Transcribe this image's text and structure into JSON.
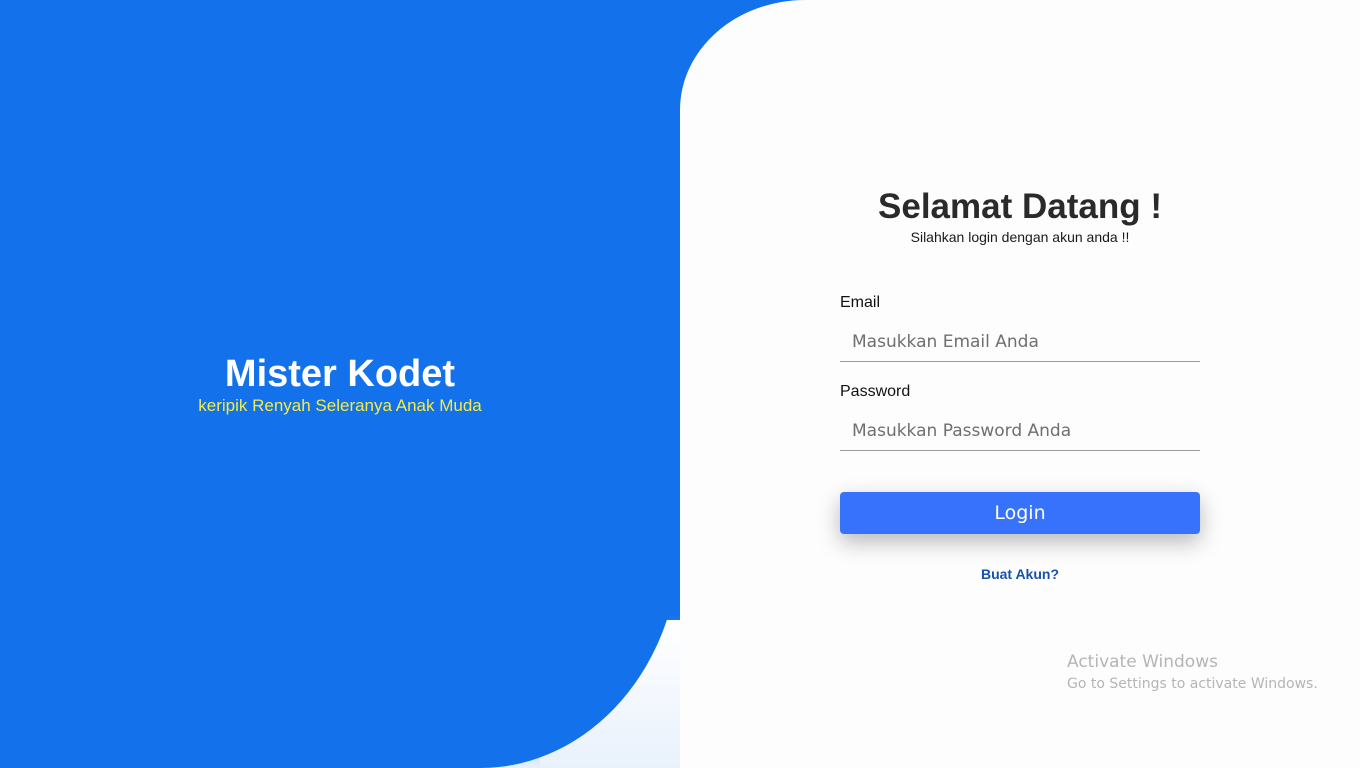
{
  "brand": {
    "title": "Mister Kodet",
    "tagline": "keripik Renyah Seleranya Anak Muda"
  },
  "login": {
    "heading": "Selamat Datang !",
    "subheading": "Silahkan login dengan akun anda !!",
    "email_label": "Email",
    "email_placeholder": "Masukkan Email Anda",
    "password_label": "Password",
    "password_placeholder": "Masukkan Password Anda",
    "login_button": "Login",
    "signup_link": "Buat Akun?"
  },
  "watermark": {
    "title": "Activate Windows",
    "subtitle": "Go to Settings to activate Windows."
  },
  "colors": {
    "primary_blue": "#1371eb",
    "button_blue": "#3672fb",
    "tagline_yellow": "#f3ec46",
    "link_blue": "#1752a8"
  }
}
